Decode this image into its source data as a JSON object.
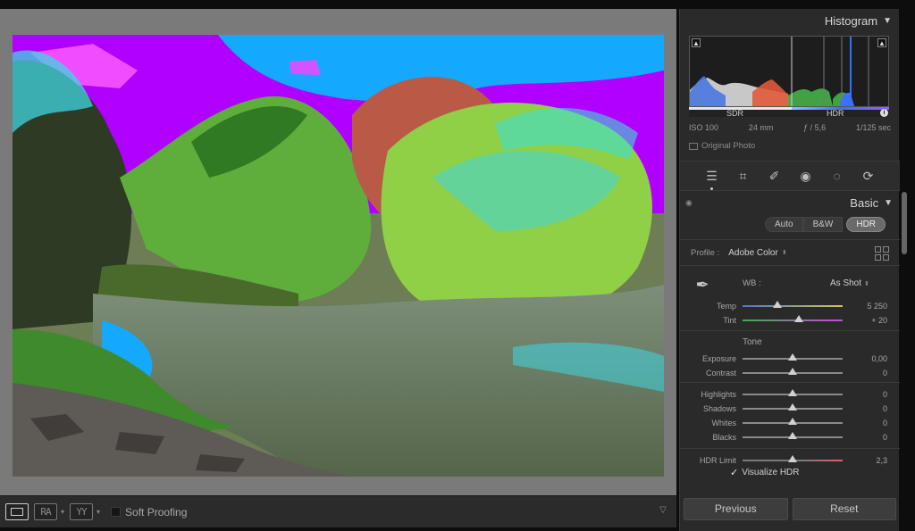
{
  "histogram": {
    "title": "Histogram",
    "sdr_label": "SDR",
    "hdr_label": "HDR",
    "info_icon": "info-icon"
  },
  "exif": {
    "iso": "ISO 100",
    "focal": "24 mm",
    "aperture": "ƒ / 5,6",
    "shutter": "1/125 sec"
  },
  "original_photo_label": "Original Photo",
  "tools": [
    "edit-sliders-icon",
    "crop-icon",
    "heal-icon",
    "red-eye-icon",
    "masking-icon",
    "presets-icon"
  ],
  "basic": {
    "title": "Basic",
    "auto_label": "Auto",
    "bw_label": "B&W",
    "hdr_label": "HDR",
    "profile_label": "Profile :",
    "profile_value": "Adobe Color",
    "wb_label": "WB :",
    "wb_value": "As Shot",
    "temp": {
      "label": "Temp",
      "value": "5 250",
      "level": 0.35
    },
    "tint": {
      "label": "Tint",
      "value": "+ 20",
      "level": 0.56
    },
    "tone_title": "Tone",
    "exposure": {
      "label": "Exposure",
      "value": "0,00",
      "level": 0.5
    },
    "contrast": {
      "label": "Contrast",
      "value": "0",
      "level": 0.5
    },
    "highlights": {
      "label": "Highlights",
      "value": "0",
      "level": 0.5
    },
    "shadows": {
      "label": "Shadows",
      "value": "0",
      "level": 0.5
    },
    "whites": {
      "label": "Whites",
      "value": "0",
      "level": 0.5
    },
    "blacks": {
      "label": "Blacks",
      "value": "0",
      "level": 0.5
    },
    "hdr_limit": {
      "label": "HDR Limit",
      "value": "2,3",
      "level": 0.5
    },
    "visualize_hdr_label": "Visualize HDR"
  },
  "toolbar": {
    "ra_label": "RA",
    "yy_label": "YY",
    "soft_proofing_label": "Soft Proofing"
  },
  "nav": {
    "previous_label": "Previous",
    "reset_label": "Reset"
  },
  "colors": {
    "sky_clip": "#b000ff",
    "sky_hdr": "#14a8ff",
    "foliage_hdr": "#34e6e0"
  }
}
